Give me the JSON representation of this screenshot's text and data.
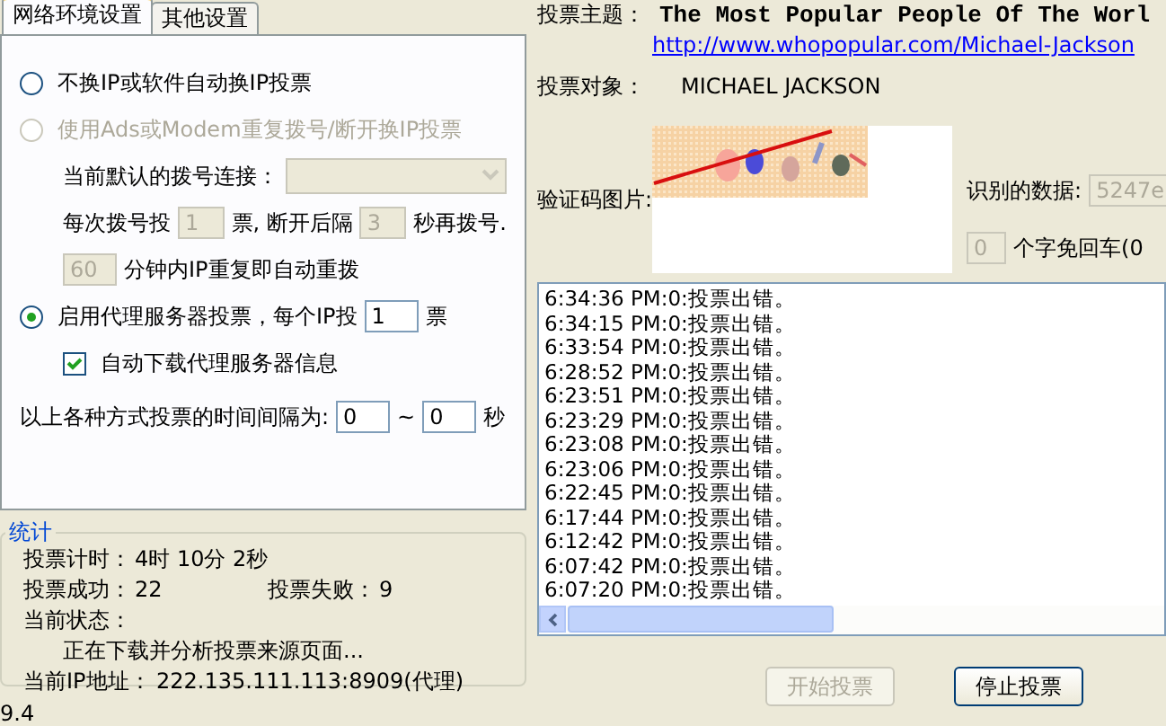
{
  "tabs": [
    {
      "label": "网络环境设置",
      "selected": true
    },
    {
      "label": "其他设置",
      "selected": false
    }
  ],
  "options": [
    {
      "label": "不换IP或软件自动换IP投票",
      "selected": false,
      "disabled": false
    },
    {
      "label": "使用Ads或Modem重复拨号/断开换IP投票",
      "selected": false,
      "disabled": true,
      "children": [
        [
          {
            "kind": "text",
            "text": "当前默认的拨号连接："
          },
          {
            "kind": "select",
            "disabled": true
          }
        ],
        [
          {
            "kind": "text",
            "text": "每次拨号投"
          },
          {
            "kind": "field",
            "value": "1",
            "disabled": true
          },
          {
            "kind": "text",
            "text": "票, 断开后隔"
          },
          {
            "kind": "field",
            "value": "3",
            "disabled": true
          },
          {
            "kind": "text",
            "text": "秒再拨号."
          }
        ],
        [
          {
            "kind": "field",
            "value": "60",
            "disabled": true
          },
          {
            "kind": "text",
            "text": "分钟内IP重复即自动重拨"
          }
        ]
      ]
    },
    {
      "label": "启用代理服务器投票，每个IP投",
      "selected": true,
      "disabled": false,
      "inline": [
        {
          "kind": "field",
          "value": "1",
          "disabled": false
        },
        {
          "kind": "text",
          "text": "票"
        }
      ],
      "children": [
        [
          {
            "kind": "checkbox",
            "label": "自动下载代理服务器信息",
            "checked": true
          }
        ]
      ]
    }
  ],
  "interval_row": [
    {
      "kind": "text",
      "text": "以上各种方式投票的时间间隔为:"
    },
    {
      "kind": "field",
      "value": "0",
      "disabled": false
    },
    {
      "kind": "text",
      "text": "~"
    },
    {
      "kind": "field",
      "value": "0",
      "disabled": false
    },
    {
      "kind": "text",
      "text": "秒"
    }
  ],
  "stats": {
    "title": "统计",
    "timer": {
      "label": "投票计时：",
      "value": "4时 10分 2秒"
    },
    "success": {
      "label": "投票成功：",
      "value": "22"
    },
    "failure": {
      "label": "投票失败：",
      "value": "9"
    },
    "status": {
      "label": "当前状态：",
      "value": "正在下载并分析投票来源页面..."
    },
    "ip": {
      "label": "当前IP地址：",
      "value": "222.135.111.113:8909(代理)"
    }
  },
  "version": "9.4",
  "subject": {
    "label": "投票主题：",
    "value": "The Most Popular People Of The Worl",
    "url": "http://www.whopopular.com/Michael-Jackson"
  },
  "target": {
    "label": "投票对象：",
    "value": "MICHAEL JACKSON"
  },
  "captcha": {
    "label": "验证码图片:",
    "recognized_label": "识别的数据:",
    "recognized": "5247e",
    "auto_enter_count": "0",
    "auto_enter_label": "个字免回车(0"
  },
  "log": [
    "6:34:36 PM:0:投票出错。",
    "6:34:15 PM:0:投票出错。",
    "6:33:54 PM:0:投票出错。",
    "6:28:52 PM:0:投票出错。",
    "6:23:51 PM:0:投票出错。",
    "6:23:29 PM:0:投票出错。",
    "6:23:08 PM:0:投票出错。",
    "6:23:06 PM:0:投票出错。",
    "6:22:45 PM:0:投票出错。",
    "6:17:44 PM:0:投票出错。",
    "6:12:42 PM:0:投票出错。",
    "6:07:42 PM:0:投票出错。",
    "6:07:20 PM:0:投票出错。"
  ],
  "buttons": [
    {
      "label": "开始投票",
      "disabled": true
    },
    {
      "label": "停止投票",
      "disabled": false
    }
  ]
}
